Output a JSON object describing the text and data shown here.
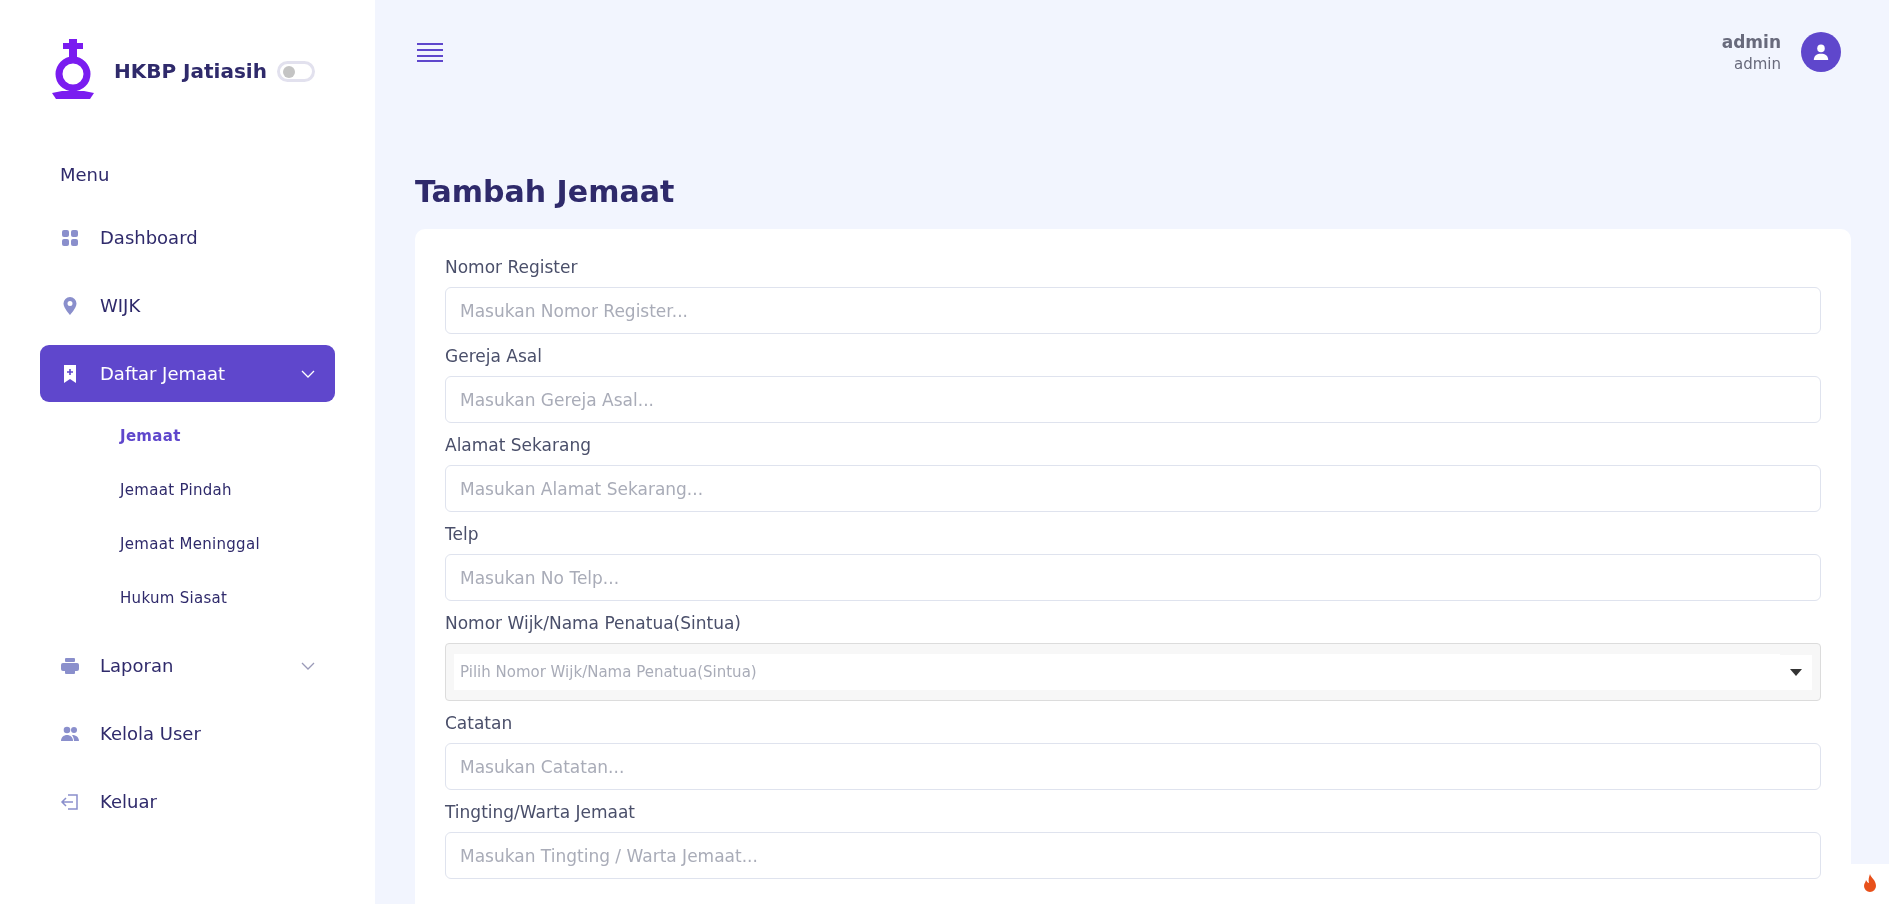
{
  "sidebar": {
    "brand": "HKBP Jatiasih",
    "theme_toggle": {
      "on": false
    },
    "section_label": "Menu",
    "items": [
      {
        "label": "Dashboard",
        "kind": "link",
        "selected": false
      },
      {
        "label": "WIJK",
        "kind": "link",
        "selected": false
      },
      {
        "label": "Daftar Jemaat",
        "kind": "group",
        "selected": true,
        "children": [
          {
            "label": "Jemaat",
            "selected": true
          },
          {
            "label": "Jemaat Pindah",
            "selected": false
          },
          {
            "label": "Jemaat Meninggal",
            "selected": false
          },
          {
            "label": "Hukum Siasat",
            "selected": false
          }
        ]
      },
      {
        "label": "Laporan",
        "kind": "group",
        "selected": false
      },
      {
        "label": "Kelola User",
        "kind": "link",
        "selected": false
      },
      {
        "label": "Keluar",
        "kind": "link",
        "selected": false
      }
    ]
  },
  "topbar": {
    "user_name": "admin",
    "user_role": "admin"
  },
  "page_title": "Tambah Jemaat",
  "form": {
    "fields": [
      {
        "label": "Nomor Register",
        "kind": "text",
        "placeholder": "Masukan Nomor Register..."
      },
      {
        "label": "Gereja Asal",
        "kind": "text",
        "placeholder": "Masukan Gereja Asal..."
      },
      {
        "label": "Alamat Sekarang",
        "kind": "text",
        "placeholder": "Masukan Alamat Sekarang..."
      },
      {
        "label": "Telp",
        "kind": "text",
        "placeholder": "Masukan No Telp..."
      },
      {
        "label": "Nomor Wijk/Nama Penatua(Sintua)",
        "kind": "select",
        "placeholder": "Pilih Nomor Wijk/Nama Penatua(Sintua)"
      },
      {
        "label": "Catatan",
        "kind": "text",
        "placeholder": "Masukan Catatan..."
      },
      {
        "label": "Tingting/Warta Jemaat",
        "kind": "text",
        "placeholder": "Masukan Tingting / Warta Jemaat..."
      }
    ]
  }
}
